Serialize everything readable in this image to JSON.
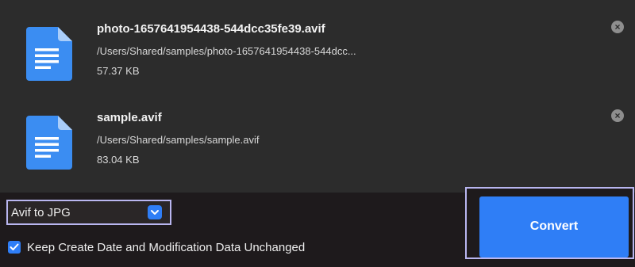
{
  "files": [
    {
      "name": "photo-1657641954438-544dcc35fe39.avif",
      "path": "/Users/Shared/samples/photo-1657641954438-544dcc...",
      "size": "57.37 KB"
    },
    {
      "name": "sample.avif",
      "path": "/Users/Shared/samples/sample.avif",
      "size": "83.04 KB"
    }
  ],
  "remove_icon": "close-circle-icon",
  "file_icon": "document-icon",
  "format_select": {
    "selected": "Avif to JPG"
  },
  "keep_dates": {
    "checked": true,
    "label": "Keep Create Date and Modification Data Unchanged"
  },
  "convert_button": {
    "label": "Convert"
  },
  "colors": {
    "accent": "#2f7ef6",
    "highlight": "#b9b6f0",
    "list_bg": "#2c2c2c",
    "bar_bg": "#1e1a1c"
  }
}
